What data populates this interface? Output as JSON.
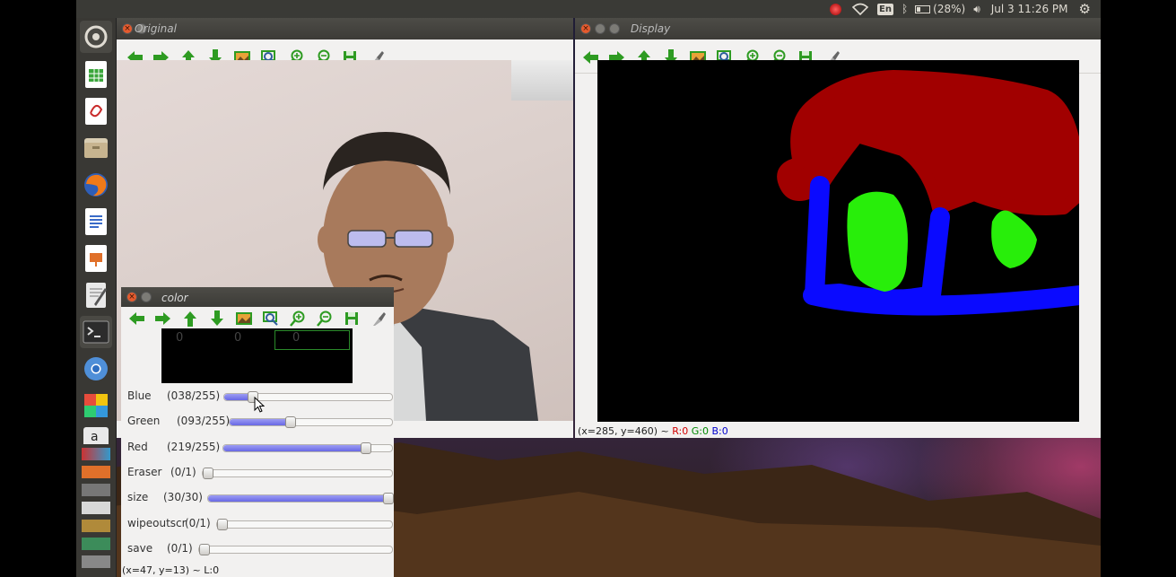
{
  "panel": {
    "keyboard_layout": "En",
    "battery": "(28%)",
    "clock": "Jul 3 11:26 PM"
  },
  "launcher": {
    "items": [
      {
        "name": "dash-home-icon"
      },
      {
        "name": "libreoffice-calc-icon"
      },
      {
        "name": "pdf-viewer-icon"
      },
      {
        "name": "files-icon"
      },
      {
        "name": "firefox-icon"
      },
      {
        "name": "libreoffice-writer-icon"
      },
      {
        "name": "libreoffice-impress-icon"
      },
      {
        "name": "text-editor-icon"
      },
      {
        "name": "terminal-icon"
      },
      {
        "name": "chromium-icon"
      },
      {
        "name": "software-center-icon"
      },
      {
        "name": "amazon-icon"
      }
    ]
  },
  "windows": {
    "original": {
      "title": "Original"
    },
    "display": {
      "title": "Display",
      "status": "(x=285, y=460) ~ ",
      "r": "R:0",
      "g": "G:0",
      "b": "B:0"
    },
    "color": {
      "title": "color",
      "preview_values": [
        "0",
        "0",
        "0"
      ],
      "trackbars": [
        {
          "name": "Blue",
          "value_text": "(038/255)",
          "value": 38,
          "max": 255
        },
        {
          "name": "Green",
          "value_text": "(093/255)",
          "value": 93,
          "max": 255
        },
        {
          "name": "Red",
          "value_text": "(219/255)",
          "value": 219,
          "max": 255
        },
        {
          "name": "Eraser",
          "value_text": "(0/1)",
          "value": 0,
          "max": 1
        },
        {
          "name": "size",
          "value_text": "(30/30)",
          "value": 30,
          "max": 30
        },
        {
          "name": "wipeoutscr",
          "value_text": "(0/1)",
          "value": 0,
          "max": 1
        },
        {
          "name": "save",
          "value_text": "(0/1)",
          "value": 0,
          "max": 1
        }
      ],
      "status": "(x=47, y=13) ~ L:0"
    }
  },
  "toolbar_icons": [
    "pan-left-icon",
    "pan-right-icon",
    "pan-up-icon",
    "pan-down-icon",
    "zoom-original-icon",
    "zoom-fit-icon",
    "zoom-in-icon",
    "zoom-out-icon",
    "save-icon",
    "properties-icon"
  ],
  "colors": {
    "paint_red": "#a10000",
    "paint_blue": "#0a0aff",
    "paint_green": "#28ee0a",
    "trackbar_fill": "#7a7aee"
  }
}
